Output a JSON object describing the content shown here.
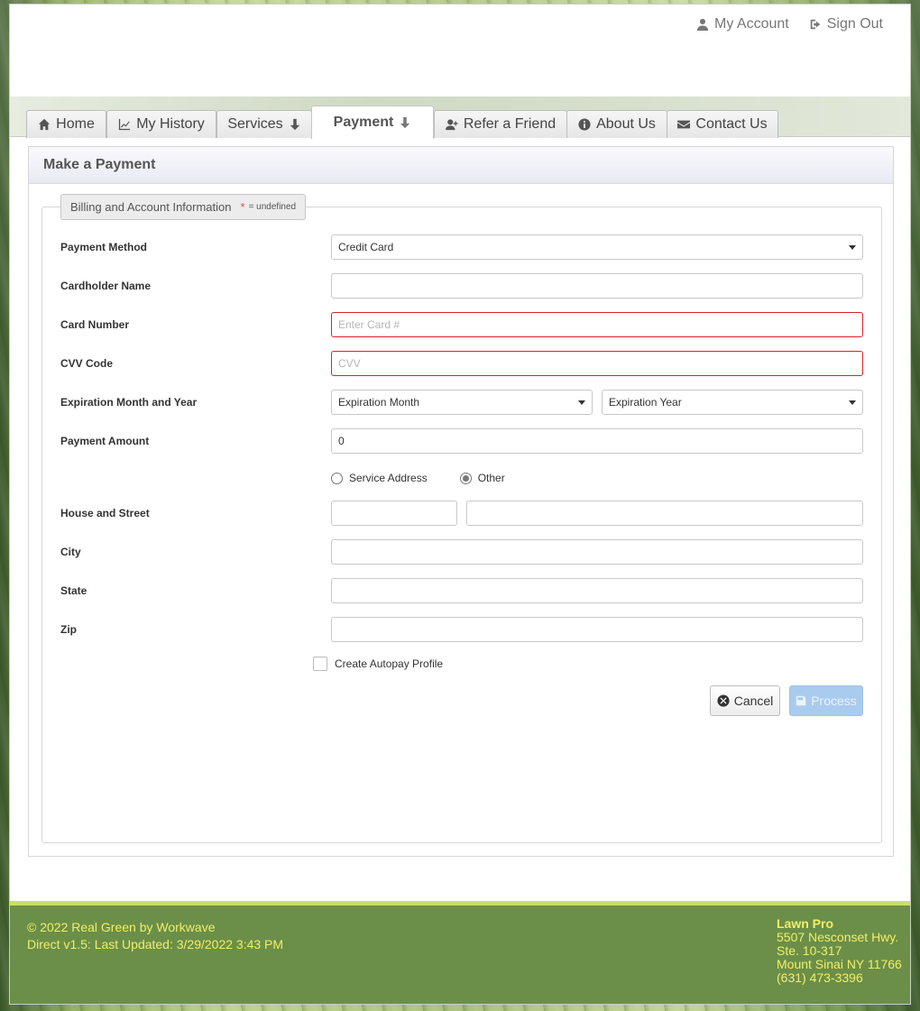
{
  "header": {
    "my_account": "My Account",
    "sign_out": "Sign Out"
  },
  "tabs": [
    {
      "label": "Home",
      "icon": "home-icon"
    },
    {
      "label": "My History",
      "icon": "line-chart-icon"
    },
    {
      "label": "Services",
      "icon": "arrow-down-icon"
    },
    {
      "label": "Payment",
      "icon": "arrow-down-icon",
      "active": true
    },
    {
      "label": "Refer a Friend",
      "icon": "user-plus-icon"
    },
    {
      "label": "About Us",
      "icon": "info-icon"
    },
    {
      "label": "Contact Us",
      "icon": "envelope-icon"
    }
  ],
  "panel": {
    "title": "Make a Payment",
    "legend": "Billing and Account Information",
    "required_marker": "*",
    "required_note": "= undefined"
  },
  "form": {
    "payment_method": {
      "label": "Payment Method",
      "value": "Credit Card"
    },
    "cardholder_name": {
      "label": "Cardholder Name",
      "value": ""
    },
    "card_number": {
      "label": "Card Number",
      "placeholder": "Enter Card #",
      "value": ""
    },
    "cvv": {
      "label": "CVV Code",
      "placeholder": "CVV",
      "value": ""
    },
    "expiration": {
      "label": "Expiration Month and Year",
      "month": "Expiration Month",
      "year": "Expiration Year"
    },
    "payment_amount": {
      "label": "Payment Amount",
      "value": "0"
    },
    "address_choice": {
      "option1": "Service Address",
      "option2": "Other",
      "selected": "Other"
    },
    "house_street": {
      "label": "House and Street",
      "number": "",
      "street": ""
    },
    "city": {
      "label": "City",
      "value": ""
    },
    "state": {
      "label": "State",
      "value": ""
    },
    "zip": {
      "label": "Zip",
      "value": ""
    },
    "autopay": {
      "label": "Create Autopay Profile",
      "checked": false
    }
  },
  "buttons": {
    "cancel": "Cancel",
    "process": "Process"
  },
  "footer": {
    "copyright": "© 2022 Real Green by Workwave",
    "version": "Direct v1.5: Last Updated: 3/29/2022 3:43 PM",
    "company": "Lawn Pro",
    "address1": "5507 Nesconset Hwy.",
    "address2": "Ste. 10-317",
    "city_state": "Mount Sinai NY 11766",
    "phone": "(631) 473-3396"
  },
  "colors": {
    "invalid_border": "#d8232a",
    "footer_bg": "#6b8f48",
    "footer_text": "#f2ee6a",
    "process_button": "#a9cbee"
  }
}
